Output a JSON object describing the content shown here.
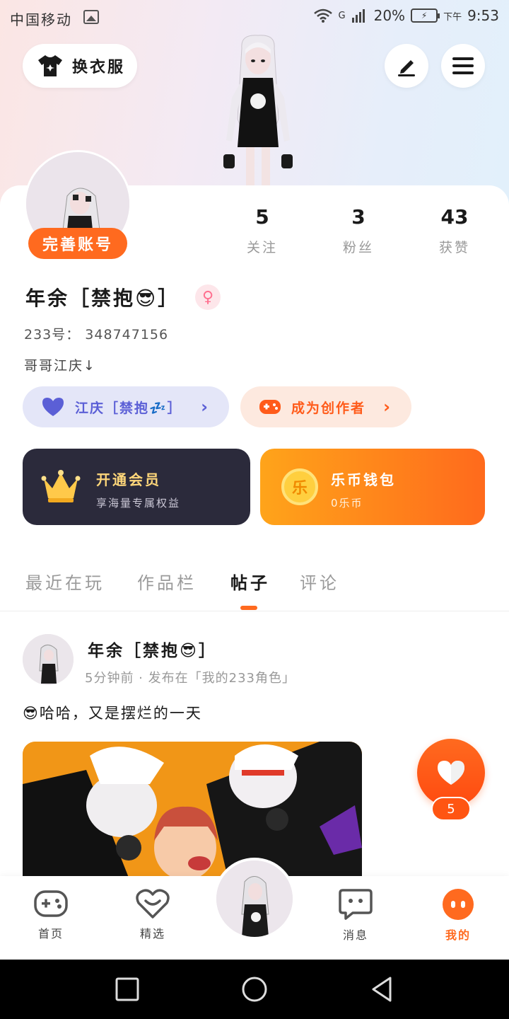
{
  "status_bar": {
    "carrier": "中国移动",
    "signal_label": "G",
    "battery": "20%",
    "time_prefix": "下午",
    "time": "9:53"
  },
  "header": {
    "outfit_label": "换衣服",
    "edit_icon": "pencil-icon",
    "menu_icon": "menu-icon"
  },
  "profile": {
    "complete_label": "完善账号",
    "stats": [
      {
        "value": "5",
        "label": "关注"
      },
      {
        "value": "3",
        "label": "粉丝"
      },
      {
        "value": "43",
        "label": "获赞"
      }
    ],
    "username": "年余［禁抱😎］",
    "gender_symbol": "♀",
    "uid": "233号： 348747156",
    "bio": "哥哥江庆↓",
    "partner_label": "江庆［禁抱💤］",
    "creator_label": "成为创作者"
  },
  "promos": {
    "vip": {
      "title": "开通会员",
      "subtitle": "享海量专属权益"
    },
    "wallet": {
      "title": "乐币钱包",
      "subtitle": "0乐币",
      "coin_char": "乐"
    }
  },
  "tabs": [
    "最近在玩",
    "作品栏",
    "帖子",
    "评论"
  ],
  "active_tab": "帖子",
  "post": {
    "author": "年余［禁抱😎］",
    "meta": "5分钟前 · 发布在「我的233角色」",
    "text": "😎哈哈，又是摆烂的一天",
    "likes": "5"
  },
  "bottom_nav": [
    {
      "label": "首页",
      "icon": "gamepad-icon"
    },
    {
      "label": "精选",
      "icon": "heart-chat-icon"
    },
    {
      "label": "消息",
      "icon": "message-icon"
    },
    {
      "label": "我的",
      "icon": "me-icon"
    }
  ],
  "colors": {
    "accent": "#ff6a1f",
    "vip_bg": "#2b2a3b",
    "partner_text": "#5b5fd6"
  }
}
